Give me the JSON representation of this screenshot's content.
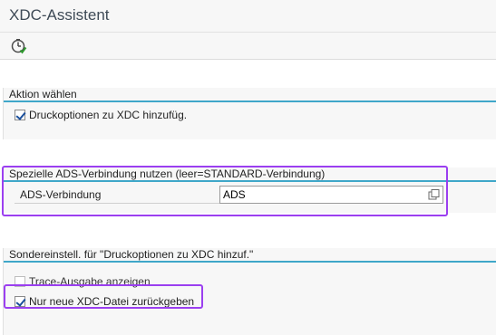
{
  "window": {
    "title": "XDC-Assistent"
  },
  "toolbar": {
    "execute_icon": "execute-clock-icon"
  },
  "groups": [
    {
      "title": "Aktion wählen",
      "checkbox": {
        "label": "Druckoptionen zu XDC hinzufüg.",
        "checked": true
      }
    },
    {
      "title": "Spezielle ADS-Verbindung nutzen (leer=STANDARD-Verbindung)",
      "field": {
        "label": "ADS-Verbindung",
        "value": "ADS",
        "help_icon": "value-help-icon"
      }
    },
    {
      "title": "Sondereinstell. für \"Druckoptionen zu XDC hinzuf.\"",
      "checkboxes": [
        {
          "label": "Trace-Ausgabe anzeigen",
          "checked": false,
          "enabled": false
        },
        {
          "label": "Nur neue XDC-Datei zurückgeben",
          "checked": true,
          "enabled": true
        }
      ]
    }
  ],
  "annotation_color": "#9b3ff0",
  "accent_color": "#3fa7c9"
}
